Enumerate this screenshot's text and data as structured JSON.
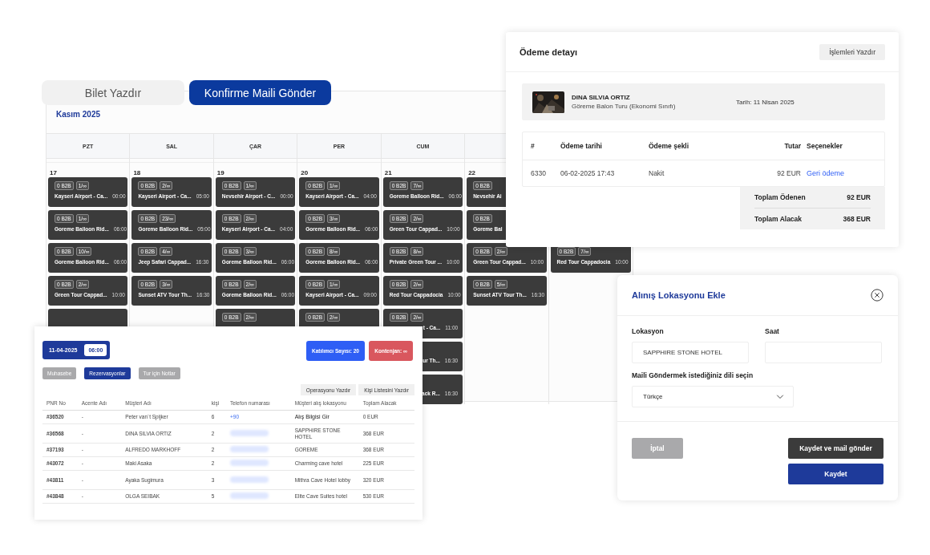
{
  "action_buttons": [
    {
      "label": "Bilet Yazdır",
      "selected": false
    },
    {
      "label": "Konfirme Maili Gönder",
      "selected": true
    }
  ],
  "calendar": {
    "month": "Kasım 2025",
    "columns": [
      {
        "day": "PZT",
        "date": "17",
        "events": [
          {
            "kind": "full",
            "b2b": "0 B2B",
            "count": "1/∞",
            "title": "Kayseri Airport - Ca...",
            "time": "00:00"
          },
          {
            "kind": "full",
            "b2b": "0 B2B",
            "count": "1/∞",
            "title": "Goreme Balloon Rid...",
            "time": "06:00"
          },
          {
            "kind": "full",
            "b2b": "0 B2B",
            "count": "10/∞",
            "title": "Goreme Balloon Rid...",
            "time": "06:00"
          },
          {
            "kind": "full",
            "b2b": "0 B2B",
            "count": "2/∞",
            "title": "Green Tour Cappad...",
            "time": "10:00"
          },
          {
            "kind": "full"
          }
        ]
      },
      {
        "day": "SAL",
        "date": "18",
        "events": [
          {
            "kind": "full",
            "b2b": "0 B2B",
            "count": "2/∞",
            "title": "Kayseri Airport - Ca...",
            "time": "05:00"
          },
          {
            "kind": "full",
            "b2b": "0 B2B",
            "count": "23/∞",
            "title": "Goreme Balloon Rid...",
            "time": "05:00"
          },
          {
            "kind": "full",
            "b2b": "0 B2B",
            "count": "4/∞",
            "title": "Jeep Safari Cappad...",
            "time": "16:30"
          },
          {
            "kind": "full",
            "b2b": "0 B2B",
            "count": "3/∞",
            "title": "Sunset ATV Tour Th...",
            "time": "16:30"
          }
        ]
      },
      {
        "day": "ÇAR",
        "date": "19",
        "events": [
          {
            "kind": "full",
            "b2b": "0 B2B",
            "count": "1/∞",
            "title": "Nevsehir Airport - C...",
            "time": "00:00"
          },
          {
            "kind": "full",
            "b2b": "0 B2B",
            "count": "2/∞",
            "title": "Kayseri Airport - Ca...",
            "time": "04:00"
          },
          {
            "kind": "full",
            "b2b": "0 B2B",
            "count": "3/∞",
            "title": "Goreme Balloon Rid...",
            "time": "06:00"
          },
          {
            "kind": "full",
            "b2b": "0 B2B",
            "count": "2/∞",
            "title": "Goreme Balloon Rid...",
            "time": "06:00"
          },
          {
            "kind": "full",
            "b2b": "0 B2B",
            "count": "2/∞"
          }
        ]
      },
      {
        "day": "PER",
        "date": "20",
        "events": [
          {
            "kind": "full",
            "b2b": "0 B2B",
            "count": "1/∞",
            "title": "Kayseri Airport - Ca...",
            "time": "04:00"
          },
          {
            "kind": "full",
            "b2b": "0 B2B",
            "count": "3/∞",
            "title": "Goreme Balloon Rid...",
            "time": "06:00"
          },
          {
            "kind": "full",
            "b2b": "0 B2B",
            "count": "8/∞",
            "title": "Goreme Balloon Rid...",
            "time": "06:00"
          },
          {
            "kind": "full",
            "b2b": "0 B2B",
            "count": "1/∞",
            "title": "Kayseri Airport - Ca...",
            "time": "09:00"
          },
          {
            "kind": "full",
            "b2b": "0 B2B",
            "count": "2/∞"
          }
        ]
      },
      {
        "day": "CUM",
        "date": "21",
        "events": [
          {
            "kind": "full",
            "b2b": "0 B2B",
            "count": "7/∞",
            "title": "Goreme Balloon Rid...",
            "time": "06:00"
          },
          {
            "kind": "full",
            "b2b": "0 B2B",
            "count": "2/∞",
            "title": "Green Tour Cappad...",
            "time": "10:00"
          },
          {
            "kind": "full",
            "b2b": "0 B2B",
            "count": "8/∞",
            "title": "Private Green Tour ...",
            "time": "10:00"
          },
          {
            "kind": "full",
            "b2b": "0 B2B",
            "count": "2/∞",
            "title": "Red Tour Cappadocia",
            "time": "10:00"
          },
          {
            "kind": "tail",
            "b2b": "0 B2B",
            "count": "2/∞",
            "title": "t - Ca...",
            "time": "11:00"
          },
          {
            "kind": "tail",
            "title": "ur Th...",
            "time": "16:30"
          },
          {
            "kind": "tail",
            "title": "ack R...",
            "time": "16:30"
          }
        ]
      },
      {
        "date": "22",
        "events": [
          {
            "kind": "full",
            "b2b": "0 B2B",
            "title": "Nevsehir Ai"
          },
          {
            "kind": "full",
            "b2b": "0 B2B",
            "title": "Goreme Bal"
          },
          {
            "kind": "full",
            "b2b": "0 B2B",
            "count": "2/∞",
            "title": "Green Tour Cappad...",
            "time": "10:00"
          },
          {
            "kind": "full",
            "b2b": "0 B2B",
            "count": "5/∞",
            "title": "Sunset ATV Tour Th...",
            "time": "16:30"
          }
        ]
      },
      {
        "events": [
          {
            "kind": "empty"
          },
          {
            "kind": "empty"
          },
          {
            "kind": "full",
            "b2b": "0 B2B",
            "count": "7/∞",
            "title": "Red Tour Cappadocia",
            "time": "10:00"
          }
        ]
      }
    ]
  },
  "tour_panel": {
    "date": "11-04-2025",
    "time": "06:00",
    "participants": "Katılımcı Sayısı: 20",
    "quota": "Kontenjan: ∞",
    "tabs": [
      {
        "label": "Muhasebe",
        "selected": false
      },
      {
        "label": "Rezervasyonlar",
        "selected": true
      },
      {
        "label": "Tur için Notlar",
        "selected": false
      }
    ],
    "print_buttons": [
      "Operasyonu Yazdır",
      "Kişi Listesini Yazdır"
    ],
    "columns": [
      "PNR No",
      "Acente Adı",
      "Müşteri Adı",
      "kişi",
      "Telefon numarası",
      "Müşteri alış lokasyonu",
      "Toplam Alacak"
    ],
    "rows": [
      {
        "pnr": "#36520",
        "agency": "-",
        "customer": "Peter van´t Spijker",
        "people": "6",
        "phone": "+90",
        "pickup_link": "Alış Bilgisi Gir",
        "total": "0 EUR"
      },
      {
        "pnr": "#36568",
        "agency": "-",
        "customer": "DINA SILVIA ORTIZ",
        "people": "2",
        "location": "SAPPHIRE STONE HOTEL",
        "total": "368 EUR"
      },
      {
        "pnr": "#37193",
        "agency": "-",
        "customer": "ALFREDO MARKHOFF",
        "people": "2",
        "location": "GOREME",
        "total": "368 EUR"
      },
      {
        "pnr": "#43072",
        "agency": "-",
        "customer": "Maki Asaka",
        "people": "2",
        "location": "Charming cave hotel",
        "total": "225 EUR"
      },
      {
        "pnr": "#43811",
        "agency": "-",
        "customer": "Ayaka Sugimura",
        "people": "3",
        "location": "Mithra Cave Hotel lobby",
        "total": "320 EUR"
      },
      {
        "pnr": "#43848",
        "agency": "-",
        "customer": "OLGA SEIBAK",
        "people": "5",
        "location": "Elite Cave Suites hotel",
        "total": "530 EUR"
      }
    ]
  },
  "payment": {
    "title": "Ödeme detayı",
    "print_button": "İşlemleri Yazdır",
    "customer": {
      "kind": "picture",
      "name": "DINA SILVIA ORTIZ",
      "tour": "Göreme Balon Turu (Ekonomi Sınıfı)",
      "date": "Tarih: 11 Nisan 2025"
    },
    "columns": [
      "#",
      "Ödeme tarihi",
      "Ödeme şekli",
      "Tutar",
      "Seçenekler"
    ],
    "rows": [
      {
        "id": "6330",
        "date": "06-02-2025 17:43",
        "method": "Nakit",
        "amount": "92 EUR",
        "action": "Geri ödeme"
      }
    ],
    "totals": [
      {
        "label": "Toplam Ödenen",
        "value": "92 EUR"
      },
      {
        "label": "Toplam Alacak",
        "value": "368 EUR"
      }
    ]
  },
  "pickup_modal": {
    "title": "Alınış Lokasyonu Ekle",
    "location": {
      "label": "Lokasyon",
      "value": "SAPPHIRE STONE HOTEL"
    },
    "time": {
      "label": "Saat"
    },
    "language": {
      "label": "Maili Göndermek istediğiniz dili seçin",
      "value": "Türkçe"
    },
    "cancel": "İptal",
    "save_and_mail": "Kaydet ve mail gönder",
    "save": "Kaydet"
  }
}
